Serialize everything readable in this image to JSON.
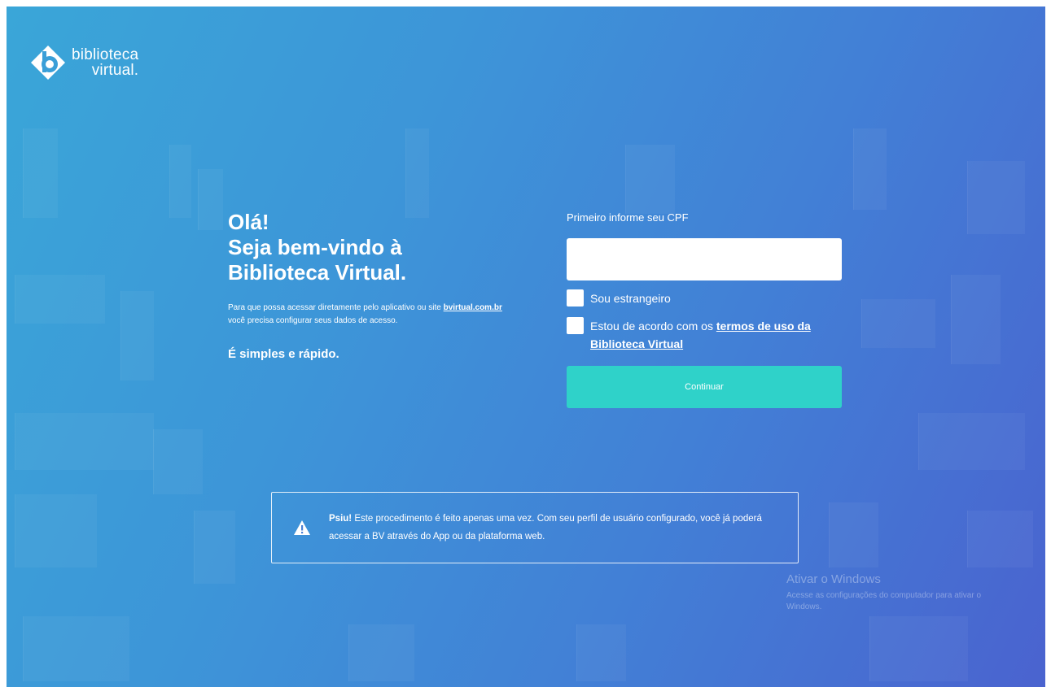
{
  "brand": {
    "line1": "biblioteca",
    "line2": "virtual.",
    "logo_icon": "bv-logo-icon",
    "accent_color": "#2fd2c9"
  },
  "welcome": {
    "line1": "Olá!",
    "line2": "Seja bem-vindo à",
    "line3": "Biblioteca Virtual.",
    "desc_before": "Para que possa acessar diretamente pelo aplicativo ou site ",
    "desc_link": "bvirtual.com.br",
    "desc_after": " você precisa configurar seus dados de acesso.",
    "simple": "É simples e rápido."
  },
  "form": {
    "cpf_label": "Primeiro informe seu CPF",
    "cpf_value": "",
    "foreigner_label": "Sou estrangeiro",
    "terms_before": "Estou de acordo com os ",
    "terms_link": "termos de uso da Biblioteca Virtual",
    "continue_label": "Continuar"
  },
  "notice": {
    "icon": "warning-icon",
    "bold": "Psiu!",
    "text": " Este procedimento é feito apenas uma vez. Com seu perfil de usuário configurado, você já poderá acessar a BV através do App ou da plataforma web."
  },
  "windows_activation": {
    "title": "Ativar o Windows",
    "subtitle": "Acesse as configurações do computador para ativar o Windows."
  }
}
